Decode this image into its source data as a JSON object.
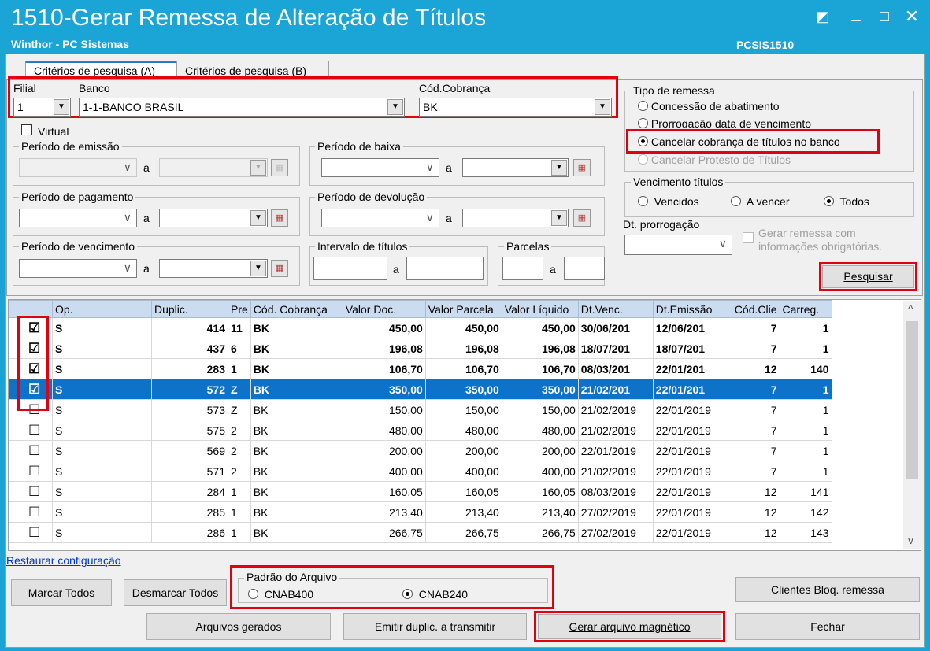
{
  "window": {
    "title": "1510-Gerar Remessa de Alteração de Títulos",
    "subtitle": "Winthor - PC Sistemas",
    "routine_code": "PCSIS1510",
    "btn_restore": "◩",
    "btn_min": "_",
    "btn_max": "□",
    "btn_close": "✕"
  },
  "tabs": [
    {
      "label": "Critérios de pesquisa (A)"
    },
    {
      "label": "Critérios de pesquisa (B)"
    }
  ],
  "filters": {
    "filial_label": "Filial",
    "filial_value": "1",
    "banco_label": "Banco",
    "banco_value": "1-1-BANCO BRASIL",
    "cobranca_label": "Cód.Cobrança",
    "cobranca_value": "BK",
    "virtual_label": "Virtual",
    "emissao_label": "Período de emissão",
    "baixa_label": "Período de baixa",
    "pagamento_label": "Período de pagamento",
    "devolucao_label": "Período de devolução",
    "vencimento_label": "Período de vencimento",
    "intervalo_label": "Intervalo de títulos",
    "parcelas_label": "Parcelas",
    "a_label": "a"
  },
  "tipo_remessa": {
    "label": "Tipo de remessa",
    "options": [
      "Concessão de abatimento",
      "Prorrogação data de vencimento",
      "Cancelar cobrança de títulos no banco",
      "Cancelar Protesto de Títulos"
    ],
    "selected": "Cancelar cobrança de títulos no banco"
  },
  "vencimento_titulos": {
    "label": "Vencimento títulos",
    "options": [
      "Vencidos",
      "A vencer",
      "Todos"
    ],
    "selected": "Todos"
  },
  "dt_prorrogacao_label": "Dt. prorrogação",
  "gerar_obrig_label_1": "Gerar remessa com",
  "gerar_obrig_label_2": "informações obrigatórias.",
  "pesquisar_label": "Pesquisar",
  "grid": {
    "columns": [
      "",
      "Op.",
      "Duplic.",
      "Pre",
      "Cód. Cobrança",
      "Valor Doc.",
      "Valor Parcela",
      "Valor Líquido",
      "Dt.Venc.",
      "Dt.Emissão",
      "Cód.Clie",
      "Carreg."
    ],
    "rows": [
      {
        "checked": "☑",
        "op": "S",
        "duplic": "414",
        "pre": "11",
        "cob": "BK",
        "vdoc": "450,00",
        "vparc": "450,00",
        "vliq": "450,00",
        "venc": "30/06/201",
        "emis": "12/06/201",
        "cli": "7",
        "carreg": "1"
      },
      {
        "checked": "☑",
        "op": "S",
        "duplic": "437",
        "pre": "6",
        "cob": "BK",
        "vdoc": "196,08",
        "vparc": "196,08",
        "vliq": "196,08",
        "venc": "18/07/201",
        "emis": "18/07/201",
        "cli": "7",
        "carreg": "1"
      },
      {
        "checked": "☑",
        "op": "S",
        "duplic": "283",
        "pre": "1",
        "cob": "BK",
        "vdoc": "106,70",
        "vparc": "106,70",
        "vliq": "106,70",
        "venc": "08/03/201",
        "emis": "22/01/201",
        "cli": "12",
        "carreg": "140"
      },
      {
        "checked": "☑",
        "op": "S",
        "duplic": "572",
        "pre": "Z",
        "cob": "BK",
        "vdoc": "350,00",
        "vparc": "350,00",
        "vliq": "350,00",
        "venc": "21/02/201",
        "emis": "22/01/201",
        "cli": "7",
        "carreg": "1"
      },
      {
        "checked": "☐",
        "op": "S",
        "duplic": "573",
        "pre": "Z",
        "cob": "BK",
        "vdoc": "150,00",
        "vparc": "150,00",
        "vliq": "150,00",
        "venc": "21/02/2019",
        "emis": "22/01/2019",
        "cli": "7",
        "carreg": "1"
      },
      {
        "checked": "☐",
        "op": "S",
        "duplic": "575",
        "pre": "2",
        "cob": "BK",
        "vdoc": "480,00",
        "vparc": "480,00",
        "vliq": "480,00",
        "venc": "21/02/2019",
        "emis": "22/01/2019",
        "cli": "7",
        "carreg": "1"
      },
      {
        "checked": "☐",
        "op": "S",
        "duplic": "569",
        "pre": "2",
        "cob": "BK",
        "vdoc": "200,00",
        "vparc": "200,00",
        "vliq": "200,00",
        "venc": "22/01/2019",
        "emis": "22/01/2019",
        "cli": "7",
        "carreg": "1"
      },
      {
        "checked": "☐",
        "op": "S",
        "duplic": "571",
        "pre": "2",
        "cob": "BK",
        "vdoc": "400,00",
        "vparc": "400,00",
        "vliq": "400,00",
        "venc": "21/02/2019",
        "emis": "22/01/2019",
        "cli": "7",
        "carreg": "1"
      },
      {
        "checked": "☐",
        "op": "S",
        "duplic": "284",
        "pre": "1",
        "cob": "BK",
        "vdoc": "160,05",
        "vparc": "160,05",
        "vliq": "160,05",
        "venc": "08/03/2019",
        "emis": "22/01/2019",
        "cli": "12",
        "carreg": "141"
      },
      {
        "checked": "☐",
        "op": "S",
        "duplic": "285",
        "pre": "1",
        "cob": "BK",
        "vdoc": "213,40",
        "vparc": "213,40",
        "vliq": "213,40",
        "venc": "27/02/2019",
        "emis": "22/01/2019",
        "cli": "12",
        "carreg": "142"
      },
      {
        "checked": "☐",
        "op": "S",
        "duplic": "286",
        "pre": "1",
        "cob": "BK",
        "vdoc": "266,75",
        "vparc": "266,75",
        "vliq": "266,75",
        "venc": "27/02/2019",
        "emis": "22/01/2019",
        "cli": "12",
        "carreg": "143"
      }
    ]
  },
  "restaurar_label": "Restaurar configuração",
  "padrao": {
    "label": "Padrão do Arquivo",
    "options": [
      "CNAB400",
      "CNAB240"
    ],
    "selected": "CNAB240"
  },
  "buttons": {
    "marcar": "Marcar Todos",
    "desmarcar": "Desmarcar Todos",
    "clientes_bloq": "Clientes Bloq. remessa",
    "arquivos": "Arquivos gerados",
    "emitir": "Emitir duplic. a transmitir",
    "gerar": "Gerar arquivo magnético",
    "fechar": "Fechar"
  },
  "colors": {
    "titlebar": "#1ba4d6",
    "selection": "#0e72c9",
    "highlight": "#e00010",
    "grid_header": "#ccdcf0"
  }
}
